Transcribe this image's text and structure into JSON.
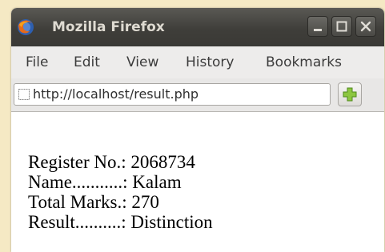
{
  "window": {
    "title": "Mozilla Firefox"
  },
  "titlebar_buttons": {
    "minimize_icon": "minimize-icon",
    "maximize_icon": "maximize-icon",
    "close_icon": "close-icon"
  },
  "menu": {
    "items": [
      {
        "label": "File"
      },
      {
        "label": "Edit"
      },
      {
        "label": "View"
      },
      {
        "label": "History"
      },
      {
        "label": "Bookmarks"
      }
    ]
  },
  "navbar": {
    "url": "http://localhost/result.php",
    "page_icon": "page-icon",
    "new_tab_icon": "plus-icon"
  },
  "result": {
    "register_no": "Register No.: 2068734",
    "name": "Name...........: Kalam",
    "total_marks": "Total Marks.: 270",
    "result": "Result..........: Distinction"
  },
  "colors": {
    "titlebar": "#3f3e3a",
    "title_text": "#dfdbd2",
    "menubar": "#edeceb",
    "new_tab_plus": "#8cc63f",
    "outer_background": "#f5e9c4"
  }
}
